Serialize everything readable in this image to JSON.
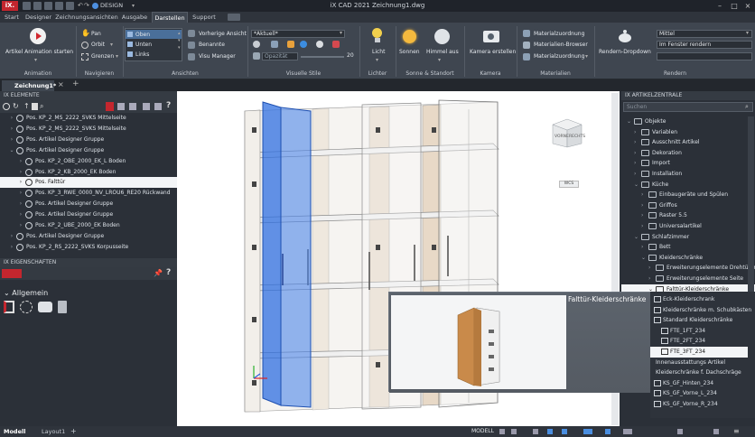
{
  "app": {
    "logo": "iX.",
    "title": "iX CAD 2021   Zeichnung1.dwg",
    "workspace": "DESIGN"
  },
  "tabs": [
    "Start",
    "Designer",
    "Zeichnungsansichten",
    "Ausgabe",
    "Darstellen",
    "Support"
  ],
  "active_tab": "Darstellen",
  "ribbon": {
    "animation": {
      "button": "Artikel Animation starten",
      "label": "Animation"
    },
    "navigieren": {
      "items": [
        "Pan",
        "Orbit",
        "Grenzen"
      ],
      "label": "Navigieren"
    },
    "ansichten": {
      "views": [
        "Oben",
        "Unten",
        "Links"
      ],
      "items": [
        "Vorherige Ansicht",
        "Benannte",
        "Visu Manager"
      ],
      "label": "Ansichten"
    },
    "visuelle": {
      "style": "*Aktuell*",
      "value": "20",
      "label": "Visuelle Stile",
      "opacity": "Opazität"
    },
    "lichter": {
      "button": "Licht",
      "label": "Lichter"
    },
    "sonne": {
      "buttons": [
        "Sonnen",
        "Himmel aus"
      ],
      "label": "Sonne & Standort"
    },
    "kamera": {
      "button": "Kamera erstellen",
      "label": "Kamera"
    },
    "materialien": {
      "items": [
        "Materialzuordnung",
        "Materialien-Browser",
        "Materialzuordnung"
      ],
      "label": "Materialien"
    },
    "rendern": {
      "button": "Rendern-Dropdown",
      "presets": [
        "Mittel",
        "Im Fenster rendern",
        ""
      ],
      "label": "Rendern"
    }
  },
  "document_tab": "Zeichnung1*",
  "elements_panel": {
    "title": "IX ELEMENTE",
    "rows": [
      {
        "text": "Pos.  KP_2_MS_2222_SVKS Mittelseite",
        "level": 1
      },
      {
        "text": "Pos.  KP_2_MS_2222_SVKS Mittelseite",
        "level": 1
      },
      {
        "text": "Pos.  Artikel Designer Gruppe",
        "level": 1
      },
      {
        "text": "Pos.  Artikel Designer Gruppe",
        "level": 1
      },
      {
        "text": "Pos.  KP_2_OBE_2000_EK_L Boden",
        "level": 2
      },
      {
        "text": "Pos.  KP_2_KB_2000_EK Boden",
        "level": 2
      },
      {
        "text": "Pos.      Falttür",
        "level": 2,
        "selected": true
      },
      {
        "text": "Pos.  KP_3_RWE_0000_NV_LROU6_RE20 Rückwand",
        "level": 2
      },
      {
        "text": "Pos.  Artikel Designer Gruppe",
        "level": 2
      },
      {
        "text": "Pos.  Artikel Designer Gruppe",
        "level": 2
      },
      {
        "text": "Pos.  KP_2_UBE_2000_EK Boden",
        "level": 2
      },
      {
        "text": "Pos.  Artikel Designer Gruppe",
        "level": 1
      },
      {
        "text": "Pos.  KP_2_RS_2222_SVKS Korpusseite",
        "level": 1
      }
    ]
  },
  "props_panel": {
    "title": "IX EIGENSCHAFTEN",
    "section": "Allgemein"
  },
  "viewport": {
    "viewcube": {
      "left": "VORNE",
      "right": "RECHTS"
    },
    "wcs": "WCS"
  },
  "article_panel": {
    "title": "IX ARTIKELZENTRALE",
    "search_placeholder": "Suchen",
    "rows": [
      {
        "text": "Objekte",
        "level": 0
      },
      {
        "text": "Variablen",
        "level": 1
      },
      {
        "text": "Ausschnitt Artikel",
        "level": 1
      },
      {
        "text": "Dekoration",
        "level": 1
      },
      {
        "text": "Import",
        "level": 1
      },
      {
        "text": "Installation",
        "level": 1
      },
      {
        "text": "Küche",
        "level": 1
      },
      {
        "text": "Einbaugeräte und Spülen",
        "level": 2
      },
      {
        "text": "Griffos",
        "level": 2
      },
      {
        "text": "Raster 5.5",
        "level": 2
      },
      {
        "text": "Universalartikel",
        "level": 2
      },
      {
        "text": "Schlafzimmer",
        "level": 1
      },
      {
        "text": "Bett",
        "level": 2
      },
      {
        "text": "Kleiderschränke",
        "level": 2
      },
      {
        "text": "Erweiterungselemente Drehtüren",
        "level": 3
      },
      {
        "text": "Erweiterungselemente Seite",
        "level": 3
      },
      {
        "text": "Falttür-Kleiderschränke",
        "level": 3,
        "selected": true
      }
    ]
  },
  "preview": {
    "title": "Falttür-Kleiderschränke"
  },
  "preview_list": [
    {
      "text": "Eck-Kleiderschrank",
      "level": 0
    },
    {
      "text": "Kleiderschränke m. Schubkästen",
      "level": 0
    },
    {
      "text": "Standard Kleiderschränke",
      "level": 0
    },
    {
      "text": "FTE_1FT_234",
      "level": 1
    },
    {
      "text": "FTE_2FT_234",
      "level": 1
    },
    {
      "text": "FTE_3FT_234",
      "level": 1,
      "selected": true
    },
    {
      "text": "Innenausstattungs Artikel",
      "level": -1
    },
    {
      "text": "Kleiderschränke f. Dachschräge",
      "level": -1
    },
    {
      "text": "KS_GF_Hinten_234",
      "level": 0
    },
    {
      "text": "KS_GF_Vorne_L_234",
      "level": 0
    },
    {
      "text": "KS_GF_Vorne_R_234",
      "level": 0
    }
  ],
  "status": {
    "tabs": [
      "Modell",
      "Layout1"
    ],
    "mode": "MODELL"
  }
}
